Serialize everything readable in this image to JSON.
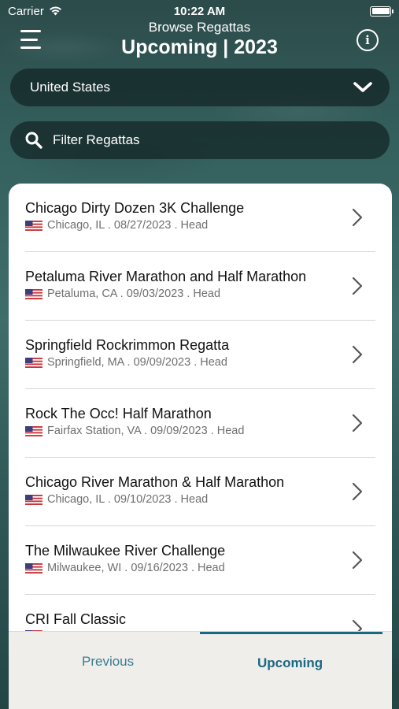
{
  "status_bar": {
    "carrier": "Carrier",
    "time": "10:22 AM"
  },
  "header": {
    "subtitle": "Browse Regattas",
    "title": "Upcoming | 2023",
    "menu_icon": "hamburger-menu-icon",
    "info_icon": "info-circle-icon",
    "info_glyph": "i"
  },
  "country_select": {
    "value": "United States",
    "icon": "chevron-down-icon"
  },
  "filter": {
    "placeholder": "Filter Regattas",
    "value": "",
    "icon": "search-icon"
  },
  "regattas": [
    {
      "name": "Chicago Dirty Dozen 3K Challenge",
      "meta": "Chicago, IL . 08/27/2023 . Head",
      "flag": "us-flag-icon"
    },
    {
      "name": "Petaluma River Marathon and Half Marathon",
      "meta": "Petaluma, CA . 09/03/2023 . Head",
      "flag": "us-flag-icon"
    },
    {
      "name": "Springfield Rockrimmon Regatta",
      "meta": "Springfield, MA . 09/09/2023 . Head",
      "flag": "us-flag-icon"
    },
    {
      "name": "Rock The Occ! Half Marathon",
      "meta": "Fairfax Station, VA . 09/09/2023 . Head",
      "flag": "us-flag-icon"
    },
    {
      "name": "Chicago River Marathon & Half Marathon",
      "meta": "Chicago, IL . 09/10/2023 . Head",
      "flag": "us-flag-icon"
    },
    {
      "name": "The Milwaukee River Challenge",
      "meta": "Milwaukee, WI . 09/16/2023 . Head",
      "flag": "us-flag-icon"
    },
    {
      "name": "CRI Fall Classic",
      "meta": "",
      "flag": "us-flag-icon"
    }
  ],
  "tabs": {
    "previous": "Previous",
    "upcoming": "Upcoming",
    "active": "upcoming"
  },
  "colors": {
    "accent": "#1b6883",
    "tab_inactive": "#3b7b90",
    "pill_bg": "#122224",
    "card_bg": "#ffffff",
    "bottom_bar_bg": "#efeeeb"
  }
}
